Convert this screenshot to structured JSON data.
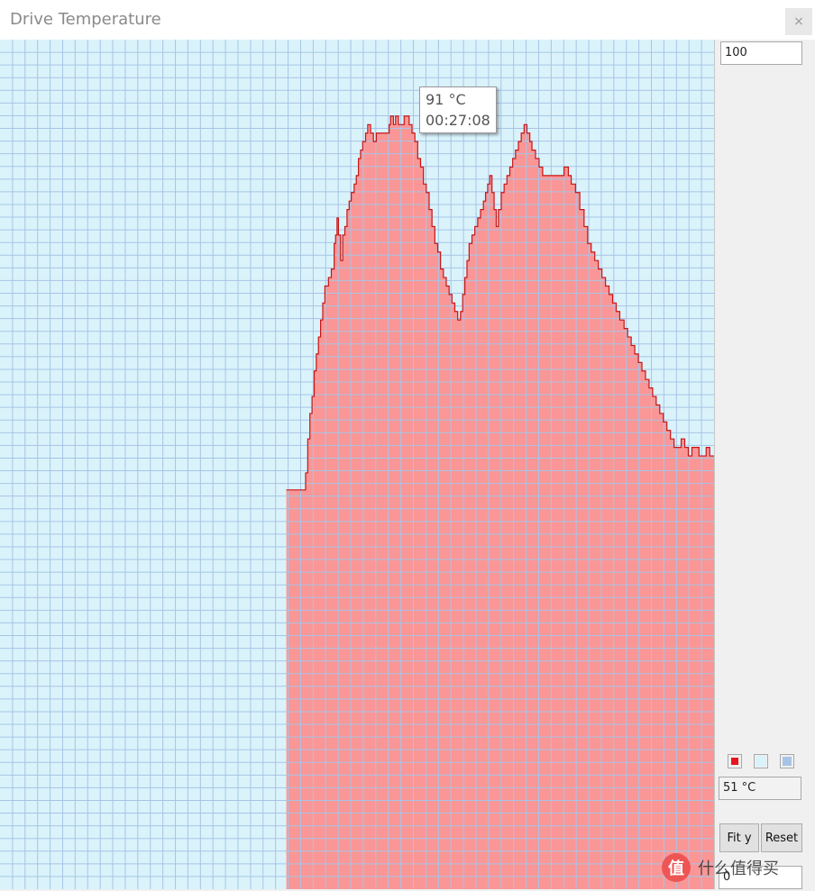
{
  "window": {
    "title": "Drive Temperature",
    "close_glyph": "×"
  },
  "tooltip": {
    "value": "91 °C",
    "time": "00:27:08"
  },
  "panel": {
    "y_max": "100",
    "current_temp": "51 °C",
    "y_min": "0",
    "fit_label": "Fit y",
    "reset_label": "Reset",
    "swatches": [
      {
        "name": "line-color",
        "color": "#e8141e"
      },
      {
        "name": "background-color",
        "color": "#daf3fb"
      },
      {
        "name": "grid-color",
        "color": "#a7c4e6"
      }
    ]
  },
  "colors": {
    "fill": "#fa9696",
    "line": "#c81414",
    "grid": "#a7c4e6",
    "plot_bg": "#daf3fb"
  },
  "watermark": {
    "logo_glyph": "值",
    "text": "什么值得买"
  },
  "chart_data": {
    "type": "area",
    "title": "",
    "xlabel": "",
    "ylabel": "",
    "ylim": [
      0,
      100
    ],
    "grid": true,
    "step": true,
    "series": [
      {
        "points": [
          [
            0.401,
            47
          ],
          [
            0.428,
            49
          ],
          [
            0.431,
            53
          ],
          [
            0.434,
            56
          ],
          [
            0.437,
            58
          ],
          [
            0.44,
            61
          ],
          [
            0.443,
            63
          ],
          [
            0.446,
            65
          ],
          [
            0.449,
            67
          ],
          [
            0.452,
            69
          ],
          [
            0.455,
            71
          ],
          [
            0.46,
            72
          ],
          [
            0.464,
            73
          ],
          [
            0.468,
            76
          ],
          [
            0.47,
            77
          ],
          [
            0.472,
            79
          ],
          [
            0.474,
            77
          ],
          [
            0.477,
            74
          ],
          [
            0.48,
            77
          ],
          [
            0.483,
            78
          ],
          [
            0.486,
            80
          ],
          [
            0.489,
            81
          ],
          [
            0.492,
            82
          ],
          [
            0.496,
            83
          ],
          [
            0.499,
            84
          ],
          [
            0.502,
            86
          ],
          [
            0.505,
            87
          ],
          [
            0.508,
            88
          ],
          [
            0.512,
            89
          ],
          [
            0.515,
            90
          ],
          [
            0.519,
            89
          ],
          [
            0.523,
            88
          ],
          [
            0.527,
            89
          ],
          [
            0.545,
            90
          ],
          [
            0.547,
            91
          ],
          [
            0.551,
            90
          ],
          [
            0.554,
            91
          ],
          [
            0.558,
            90
          ],
          [
            0.566,
            91
          ],
          [
            0.573,
            90
          ],
          [
            0.577,
            89
          ],
          [
            0.581,
            88
          ],
          [
            0.585,
            86
          ],
          [
            0.589,
            85
          ],
          [
            0.593,
            83
          ],
          [
            0.597,
            82
          ],
          [
            0.601,
            80
          ],
          [
            0.605,
            78
          ],
          [
            0.609,
            76
          ],
          [
            0.613,
            75
          ],
          [
            0.617,
            73
          ],
          [
            0.621,
            72
          ],
          [
            0.625,
            71
          ],
          [
            0.629,
            70
          ],
          [
            0.633,
            69
          ],
          [
            0.637,
            68
          ],
          [
            0.641,
            67
          ],
          [
            0.645,
            68
          ],
          [
            0.648,
            70
          ],
          [
            0.651,
            72
          ],
          [
            0.654,
            74
          ],
          [
            0.657,
            76
          ],
          [
            0.661,
            77
          ],
          [
            0.665,
            78
          ],
          [
            0.669,
            79
          ],
          [
            0.673,
            80
          ],
          [
            0.677,
            81
          ],
          [
            0.68,
            82
          ],
          [
            0.683,
            83
          ],
          [
            0.686,
            84
          ],
          [
            0.689,
            82
          ],
          [
            0.692,
            80
          ],
          [
            0.695,
            78
          ],
          [
            0.698,
            80
          ],
          [
            0.702,
            82
          ],
          [
            0.706,
            83
          ],
          [
            0.71,
            84
          ],
          [
            0.714,
            85
          ],
          [
            0.718,
            86
          ],
          [
            0.722,
            87
          ],
          [
            0.726,
            88
          ],
          [
            0.73,
            89
          ],
          [
            0.734,
            90
          ],
          [
            0.738,
            89
          ],
          [
            0.742,
            88
          ],
          [
            0.745,
            87
          ],
          [
            0.75,
            86
          ],
          [
            0.755,
            85
          ],
          [
            0.76,
            84
          ],
          [
            0.79,
            85
          ],
          [
            0.796,
            84
          ],
          [
            0.8,
            83
          ],
          [
            0.806,
            82
          ],
          [
            0.812,
            80
          ],
          [
            0.818,
            78
          ],
          [
            0.823,
            76
          ],
          [
            0.828,
            75
          ],
          [
            0.833,
            74
          ],
          [
            0.838,
            73
          ],
          [
            0.843,
            72
          ],
          [
            0.848,
            71
          ],
          [
            0.853,
            70
          ],
          [
            0.858,
            69
          ],
          [
            0.863,
            68
          ],
          [
            0.868,
            67
          ],
          [
            0.874,
            66
          ],
          [
            0.879,
            65
          ],
          [
            0.884,
            64
          ],
          [
            0.889,
            63
          ],
          [
            0.894,
            62
          ],
          [
            0.899,
            61
          ],
          [
            0.904,
            60
          ],
          [
            0.909,
            59
          ],
          [
            0.914,
            58
          ],
          [
            0.919,
            57
          ],
          [
            0.924,
            56
          ],
          [
            0.929,
            55
          ],
          [
            0.934,
            54
          ],
          [
            0.939,
            53
          ],
          [
            0.944,
            52
          ],
          [
            0.949,
            52
          ],
          [
            0.954,
            53
          ],
          [
            0.959,
            52
          ],
          [
            0.964,
            51
          ],
          [
            0.969,
            52
          ],
          [
            0.974,
            52
          ],
          [
            0.979,
            51
          ],
          [
            0.984,
            51
          ],
          [
            0.989,
            52
          ],
          [
            0.994,
            51
          ],
          [
            1.0,
            51
          ]
        ]
      }
    ]
  }
}
